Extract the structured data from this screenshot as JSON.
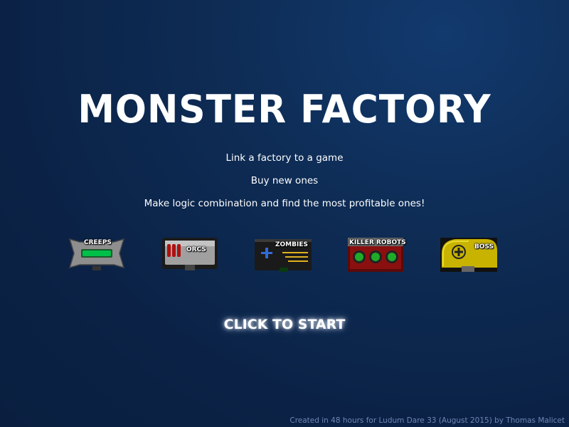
{
  "title": "MONSTER FACTORY",
  "instructions": [
    "Link a factory to a game",
    "Buy new ones",
    "Make logic combination and find the most profitable ones!"
  ],
  "factories": [
    {
      "label": "CREEPS",
      "color": "#00c04a"
    },
    {
      "label": "ORCS",
      "color": "#b01010"
    },
    {
      "label": "ZOMBIES",
      "color": "#2f6bd6"
    },
    {
      "label": "KILLER ROBOTS",
      "color": "#1faa2a"
    },
    {
      "label": "BOSS",
      "color": "#d8c400"
    }
  ],
  "start_label": "CLICK TO START",
  "credits": "Created in 48 hours for Ludum Dare 33 (August 2015) by Thomas Malicet"
}
